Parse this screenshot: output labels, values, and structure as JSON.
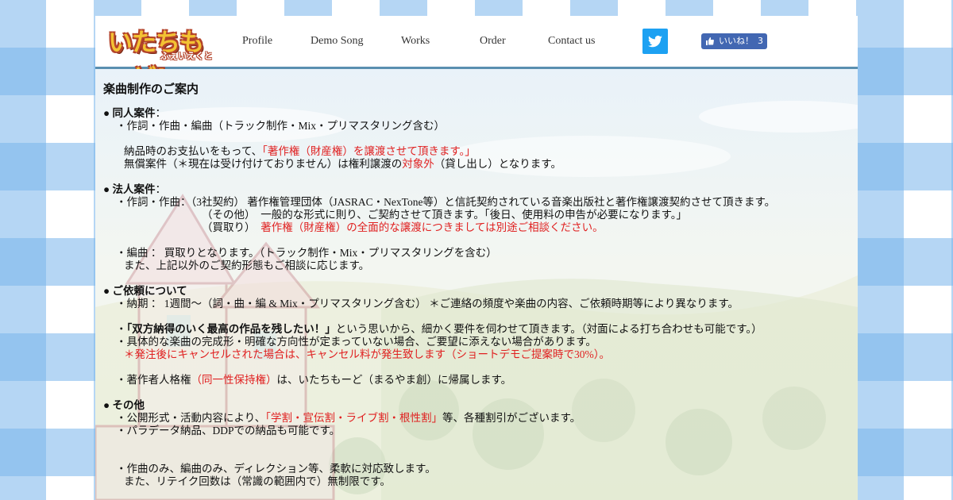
{
  "logo": {
    "main": "いたちもーど!",
    "sub": "ふぇいえくと"
  },
  "nav": {
    "items": [
      "Profile",
      "Demo Song",
      "Works",
      "Order",
      "Contact us"
    ]
  },
  "social": {
    "twitter_icon": "twitter-bird-icon",
    "fb_like_label": "いいね！",
    "fb_like_count": "3"
  },
  "colors": {
    "accent_red": "#e02020",
    "header_border": "#5a8fb0",
    "twitter": "#1da1f2",
    "facebook": "#4267b2"
  },
  "content": {
    "title": "楽曲制作のご案内",
    "doujin": {
      "heading": "● 同人案件",
      "colon": "：",
      "item1": "・作詞・作曲・編曲（トラック制作・Mix・プリマスタリング含む）",
      "line2_pre": "納品時のお支払いをもって、",
      "line2_red": "「著作権（財産権）を譲渡させて頂きます。」",
      "line3_pre": "無償案件（＊現在は受け付けておりません）は権利譲渡の",
      "line3_red": "対象外",
      "line3_post": "（貸し出し）となります。"
    },
    "corp": {
      "heading": "● 法人案件",
      "colon": "：",
      "item1": "・作詞・作曲：（3社契約） 著作権管理団体（JASRAC・NexTone等）と信託契約されている音楽出版社と著作権譲渡契約させて頂きます。",
      "item2": "（その他）　一般的な形式に則り、ご契約させて頂きます。「後日、使用料の申告が必要になります。」",
      "item3_pre": "（買取り）　",
      "item3_red": "著作権（財産権）の全面的な譲渡につきましては別途ご相談ください。",
      "item4": "・編曲 ： 買取りとなります。（トラック制作・Mix・プリマスタリングを含む）",
      "item5": "また、上記以外のご契約形態もご相談に応じます。"
    },
    "request": {
      "heading": "● ご依頼について",
      "item1": "・納期 ： 1週間～（詞・曲・編 & Mix・プリマスタリング含む） ＊ご連絡の頻度や楽曲の内容、ご依頼時期等により異なります。",
      "item2_pre": "・",
      "item2_bold": "「双方納得のいく最高の作品を残したい！」",
      "item2_post": "という思いから、細かく要件を伺わせて頂きます。（対面による打ち合わせも可能です。）",
      "item3": "・具体的な楽曲の完成形・明確な方向性が定まっていない場合、ご要望に添えない場合があります。",
      "item4_red": "＊発注後にキャンセルされた場合は、キャンセル料が発生致します（ショートデモご提案時で30%）。",
      "item5_pre": "・著作者人格権",
      "item5_red": "（同一性保持権）",
      "item5_post": "は、いたちもーど（まるやま創）に帰属します。"
    },
    "other": {
      "heading": "● その他",
      "item1_pre": "・公開形式・活動内容により、",
      "item1_red": "「学割・宣伝割・ライブ割・根性割」",
      "item1_post": "等、各種割引がございます。",
      "item2": "・パラデータ納品、DDPでの納品も可能です。",
      "item3": "・作曲のみ、編曲のみ、ディレクション等、柔軟に対応致します。",
      "item4": "また、リテイク回数は（常識の範囲内で）無制限です。"
    }
  }
}
